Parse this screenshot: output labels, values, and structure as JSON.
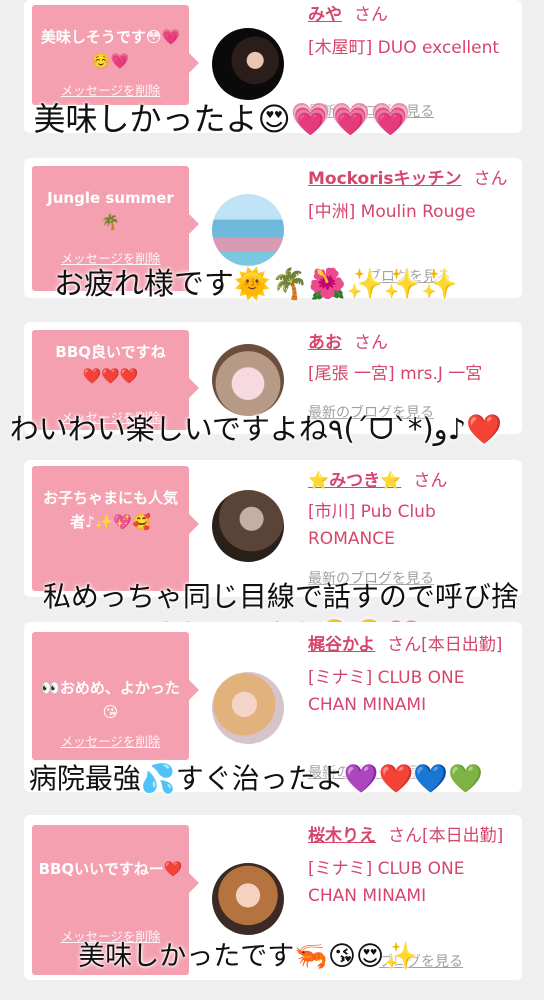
{
  "cards": [
    {
      "message": "美味しそうです😳💗☺️💗",
      "delete_label": "メッセージを削除",
      "user": "みや",
      "honorific": "さん",
      "shop": "[木屋町] DUO excellent",
      "blog_label": "最新のブログを見る",
      "overlay": "美味しかったよ😍💗💗💗"
    },
    {
      "message": "Jungle summer🌴",
      "delete_label": "メッセージを削除",
      "user": "Mockorisキッチン",
      "honorific": "さん",
      "shop": "[中洲] Moulin Rouge",
      "blog_label": "ブログを見る",
      "overlay": "お疲れ様です🌞🌴🌺✨✨✨"
    },
    {
      "message": "BBQ良いですね❤️❤️❤️",
      "delete_label": "メッセージを削除",
      "user": "あお",
      "honorific": "さん",
      "shop": "[尾張 一宮] mrs.J 一宮",
      "blog_label": "最新のブログを見る",
      "overlay": "わいわい楽しいですよね٩(ˊᗜˋ*)و♪❤️"
    },
    {
      "message": "お子ちゃまにも人気者♪✨💖🥰",
      "delete_label": "メッセージを削除",
      "user": "⭐みつき⭐",
      "honorific": "さん",
      "shop": "[市川] Pub Club ROMANCE",
      "blog_label": "最新のブログを見る",
      "overlay": "私めっちゃ同じ目線で話すので呼び捨\nてされてますよ🤣🤣💗"
    },
    {
      "message": "👀おめめ、よかった😘",
      "delete_label": "メッセージを削除",
      "user": "梶谷かよ",
      "honorific": "さん[本日出勤]",
      "shop": "[ミナミ] CLUB ONE CHAN MINAMI",
      "blog_label": "最新のブログを見る",
      "overlay": "病院最強💦すぐ治ったよ💜❤️💙💚"
    },
    {
      "message": "BBQいいですねー❤️",
      "delete_label": "メッセージを削除",
      "user": "桜木りえ",
      "honorific": "さん[本日出勤]",
      "shop": "[ミナミ] CLUB ONE CHAN MINAMI",
      "blog_label": "ブログを見る",
      "overlay": "美味しかったです🦐😘😍✨"
    }
  ],
  "colors": {
    "bubble": "#f4a0b0",
    "link": "#d6456b",
    "background": "#f0eff0"
  }
}
